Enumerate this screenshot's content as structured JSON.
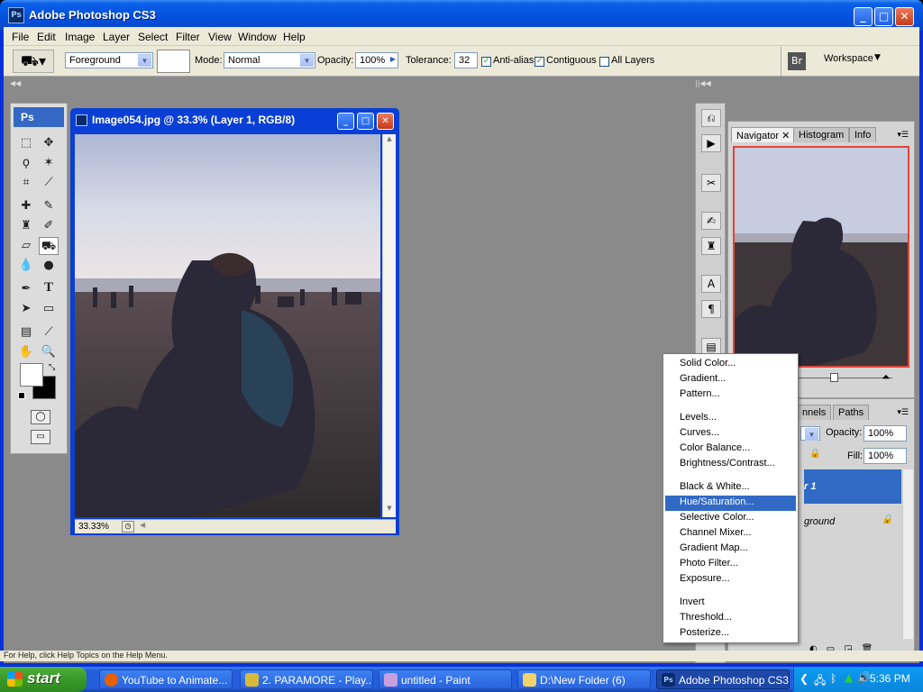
{
  "window": {
    "title": "Adobe Photoshop CS3",
    "icon_name": "photoshop-app-icon",
    "min": "_",
    "max": "□",
    "close": "✕"
  },
  "menubar": [
    "File",
    "Edit",
    "Image",
    "Layer",
    "Select",
    "Filter",
    "View",
    "Window",
    "Help"
  ],
  "options": {
    "fill_source": "Foreground",
    "mode_label": "Mode:",
    "mode_value": "Normal",
    "opacity_label": "Opacity:",
    "opacity_value": "100%",
    "tolerance_label": "Tolerance:",
    "tolerance_value": "32",
    "antialias_label": "Anti-alias",
    "contiguous_label": "Contiguous",
    "all_layers_label": "All Layers",
    "workspace_label": "Workspace"
  },
  "toolbox": {
    "logo": "Ps"
  },
  "document": {
    "title": "Image054.jpg @ 33.3% (Layer 1, RGB/8)",
    "zoom": "33.33%"
  },
  "navigator": {
    "tabs": [
      "Navigator",
      "Histogram",
      "Info"
    ]
  },
  "layers": {
    "tabs": [
      "nnels",
      "Paths"
    ],
    "opacity_label": "Opacity:",
    "opacity_value": "100%",
    "fill_label": "Fill:",
    "fill_value": "100%",
    "layer1_label": "r 1",
    "background_label": "ground"
  },
  "adjust_menu": {
    "groups": [
      [
        "Solid Color...",
        "Gradient...",
        "Pattern..."
      ],
      [
        "Levels...",
        "Curves...",
        "Color Balance...",
        "Brightness/Contrast..."
      ],
      [
        "Black & White...",
        "Hue/Saturation...",
        "Selective Color...",
        "Channel Mixer...",
        "Gradient Map...",
        "Photo Filter...",
        "Exposure..."
      ],
      [
        "Invert",
        "Threshold...",
        "Posterize..."
      ]
    ],
    "highlighted": "Hue/Saturation..."
  },
  "helpbar": "For Help, click Help Topics on the Help Menu.",
  "taskbar": {
    "start": "start",
    "tasks": [
      "YouTube to Animate...",
      "2. PARAMORE - Play...",
      "untitled - Paint",
      "D:\\New Folder (6)",
      "Adobe Photoshop CS3"
    ],
    "clock": "5:36 PM"
  },
  "colors": {
    "accent": "#316ac5",
    "xp_blue": "#0a5fe8",
    "nav_border": "#e0453a"
  }
}
